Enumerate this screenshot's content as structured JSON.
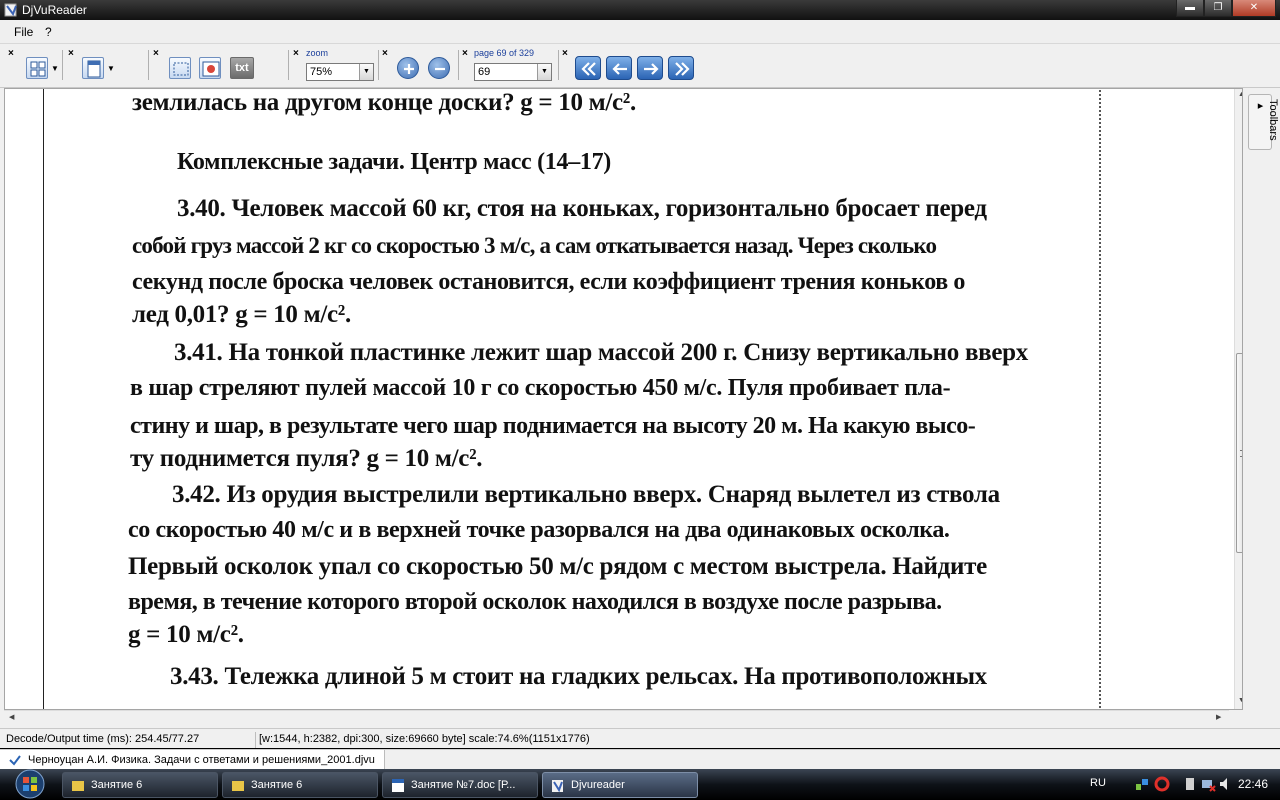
{
  "window": {
    "title": "DjVuReader",
    "controls": {
      "minimize": "▬",
      "maximize": "❐",
      "close": "✕"
    }
  },
  "menu": {
    "items": [
      "File",
      "?"
    ]
  },
  "toolbar": {
    "zoom_label": "zoom",
    "zoom_value": "75%",
    "page_label": "page 69 of 329",
    "page_value": "69",
    "text_button_label": "txt",
    "close_glyph": "×"
  },
  "document": {
    "lines": [
      {
        "text": "землилась на другом конце доски? g = 10 м/с²."
      },
      {
        "text": "Комплексные задачи. Центр масс (14–17)"
      },
      {
        "text": "3.40. Человек массой 60 кг, стоя на коньках, горизонтально бросает перед"
      },
      {
        "text": "собой груз массой 2 кг со скоростью 3 м/с, а сам откатывается назад. Через сколько"
      },
      {
        "text": "секунд после броска человек остановится, если коэффициент трения коньков о"
      },
      {
        "text": "лед 0,01? g = 10 м/с²."
      },
      {
        "text": "3.41. На тонкой пластинке лежит шар массой 200 г. Снизу вертикально вверх"
      },
      {
        "text": "в шар стреляют пулей массой 10 г со скоростью 450 м/с. Пуля пробивает пла-"
      },
      {
        "text": "стину и шар, в результате чего шар поднимается на высоту 20 м. На какую высо-"
      },
      {
        "text": "ту поднимется пуля? g = 10 м/с²."
      },
      {
        "text": "3.42. Из орудия выстрелили вертикально вверх. Снаряд вылетел из ствола"
      },
      {
        "text": "со скоростью 40 м/с и в верхней точке разорвался на два одинаковых осколка."
      },
      {
        "text": "Первый осколок упал со скоростью 50 м/с рядом с местом выстрела. Найдите"
      },
      {
        "text": "время, в течение которого второй осколок находился в воздухе после разрыва."
      },
      {
        "text": "g = 10 м/с²."
      },
      {
        "text": "3.43. Тележка длиной 5 м стоит на гладких рельсах. На противоположных"
      }
    ]
  },
  "side_panel": {
    "toolbars_label": "Toolbars ▸"
  },
  "status": {
    "decode_time": "Decode/Output time (ms): 254.45/77.27",
    "image_info": "[w:1544, h:2382, dpi:300, size:69660 byte] scale:74.6%(1151x1776)"
  },
  "doc_tab": {
    "title": "Черноуцан А.И. Физика. Задачи с ответами и решениями_2001.djvu"
  },
  "taskbar": {
    "tasks": [
      {
        "label": "Занятие 6"
      },
      {
        "label": "Занятие 6"
      },
      {
        "label": "Занятие №7.doc [Р..."
      },
      {
        "label": "Djvureader"
      }
    ],
    "language": "RU",
    "clock": "22:46"
  },
  "colors": {
    "titlebar": "#111111",
    "accent": "#2b64b4",
    "taskbar": "#0e1218"
  },
  "icons": [
    "app-icon",
    "layout-icon",
    "page-icon",
    "select-rect-icon",
    "image-icon",
    "zoom-in-icon",
    "zoom-out-icon",
    "first-page-icon",
    "prev-page-icon",
    "next-page-icon",
    "last-page-icon",
    "start-orb-icon"
  ]
}
